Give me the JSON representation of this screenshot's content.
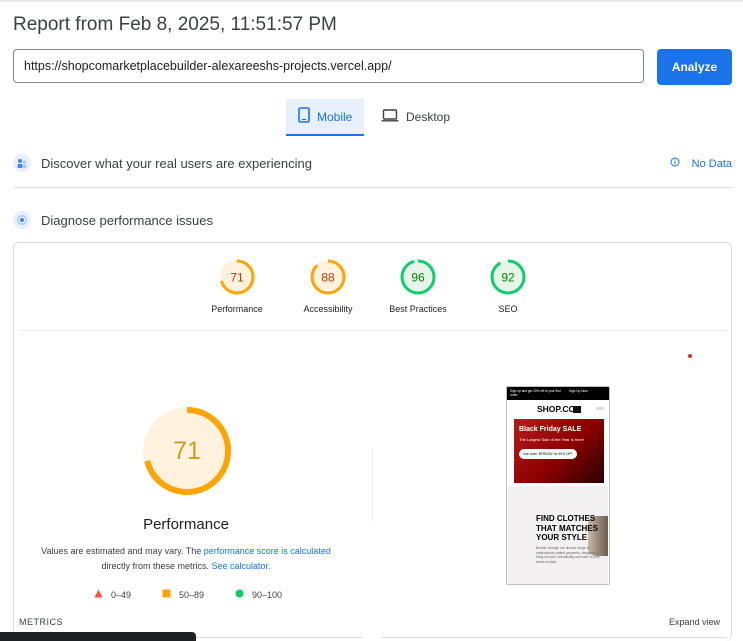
{
  "header": {
    "title": "Report from Feb 8, 2025, 11:51:57 PM"
  },
  "url_input": {
    "value": "https://shopcomarketplacebuilder-alexareeshs-projects.vercel.app/"
  },
  "analyze_button": {
    "label": "Analyze"
  },
  "device_tabs": [
    {
      "label": "Mobile",
      "icon": "smartphone-icon",
      "selected": true
    },
    {
      "label": "Desktop",
      "icon": "laptop-icon",
      "selected": false
    }
  ],
  "field_data": {
    "heading": "Discover what your real users are experiencing",
    "status": "No Data",
    "icon": "users-icon"
  },
  "lab_data": {
    "heading": "Diagnose performance issues",
    "icon": "lab-icon"
  },
  "scores": [
    {
      "label": "Performance",
      "value": 71,
      "color": "#ffa400"
    },
    {
      "label": "Accessibility",
      "value": 88,
      "color": "#ffa400"
    },
    {
      "label": "Best Practices",
      "value": 96,
      "color": "#0cce6b"
    },
    {
      "label": "SEO",
      "value": 92,
      "color": "#0cce6b"
    }
  ],
  "performance": {
    "value": 71,
    "label": "Performance",
    "desc_prefix": "Values are estimated and may vary. The ",
    "desc_link1": "performance score is calculated",
    "desc_middle": "directly from these metrics. ",
    "desc_link2": "See calculator."
  },
  "legend": [
    {
      "range": "0–49",
      "color": "#ff4e42",
      "shape": "triangle"
    },
    {
      "range": "50–89",
      "color": "#ffa400",
      "shape": "square"
    },
    {
      "range": "90–100",
      "color": "#0cce6b",
      "shape": "circle"
    }
  ],
  "screenshot": {
    "promo": "Sign up and get 20% off to your first order.",
    "signup": "Sign Up Now",
    "logo": "SHOP.CO",
    "banner_title": "Black Friday SALE",
    "banner_sub": "The Largest Sale of the Year is here!",
    "banner_code": "Use code: BFRIDAY for 50% OFF",
    "hero": "FIND CLOTHES THAT MATCHES YOUR STYLE",
    "hero_sub": "Browse through our diverse range of meticulously crafted garments, designed to bring out your individuality and cater to your sense of style."
  },
  "footer": {
    "metrics_label": "METRICS",
    "expand_label": "Expand view"
  }
}
